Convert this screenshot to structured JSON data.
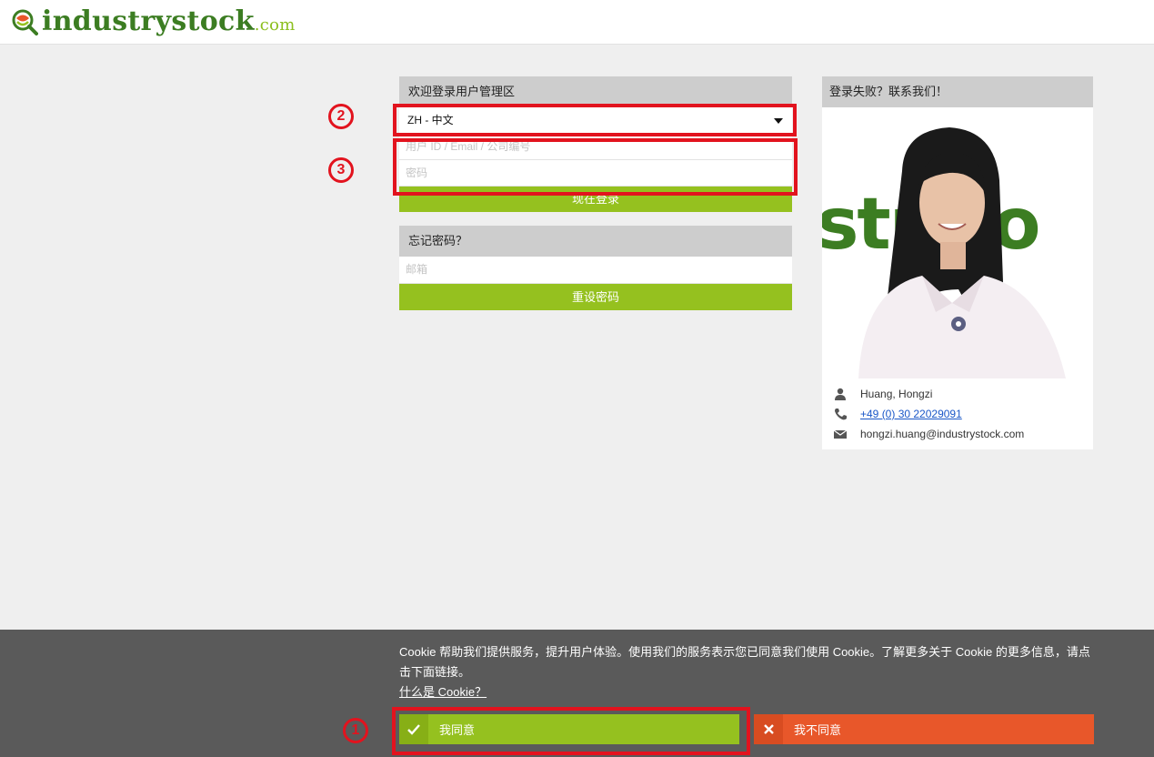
{
  "header": {
    "logo_main": "industry",
    "logo_stock": "stock",
    "logo_com": ".com"
  },
  "login": {
    "title": "欢迎登录用户管理区",
    "language": "ZH - 中文",
    "user_placeholder": "用户 ID / Email / 公司编号",
    "password_placeholder": "密码",
    "login_button": "现在登录"
  },
  "forgot": {
    "title": "忘记密码？",
    "email_placeholder": "邮箱",
    "reset_button": "重设密码"
  },
  "contact": {
    "title": "登录失败？联系我们！",
    "photo_text": "str   oo",
    "name": "Huang, Hongzi",
    "phone": "+49 (0) 30 22029091",
    "email": "hongzi.huang@industrystock.com"
  },
  "cookie": {
    "text": "Cookie 帮助我们提供服务，提升用户体验。使用我们的服务表示您已同意我们使用 Cookie。了解更多关于 Cookie 的更多信息，请点击下面链接。",
    "link": "什么是 Cookie？",
    "agree": "我同意",
    "disagree": "我不同意"
  },
  "annotations": {
    "badge_1": "1",
    "badge_2": "2",
    "badge_3": "3"
  },
  "colors": {
    "accent_green": "#95c11f",
    "brand_green": "#3c7d22",
    "disagree_orange": "#e8572a",
    "annotation_red": "#e2131e"
  }
}
